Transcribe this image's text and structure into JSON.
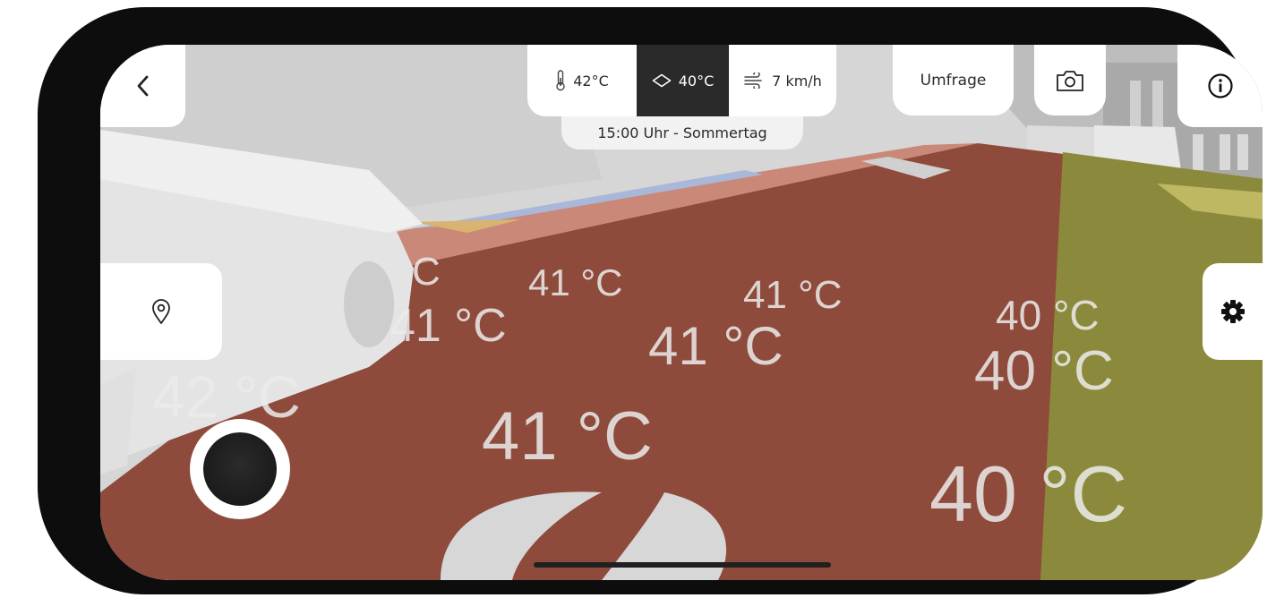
{
  "stats": {
    "air_temp": "42°C",
    "surface_temp": "40°C",
    "wind": "7 km/h"
  },
  "time_label": "15:00 Uhr - Sommertag",
  "survey_label": "Umfrage",
  "overlay_labels": [
    {
      "text": "C"
    },
    {
      "text": "41 °C"
    },
    {
      "text": "41 °C"
    },
    {
      "text": "41 °C"
    },
    {
      "text": "41 °C"
    },
    {
      "text": "42 °C"
    },
    {
      "text": "41 °C"
    },
    {
      "text": "40 °C"
    },
    {
      "text": "40 °C"
    },
    {
      "text": "40 °C"
    }
  ],
  "colors": {
    "hot_zone": "#8e4a3a",
    "warm_zone": "#8b8a3c",
    "surface_active": "#2a2a2a"
  },
  "icons": {
    "back": "chevron-left-icon",
    "air": "thermometer-icon",
    "surface": "diamond-icon",
    "wind": "wind-icon",
    "camera": "camera-icon",
    "info": "info-icon",
    "location": "map-pin-icon",
    "settings": "gear-icon"
  }
}
